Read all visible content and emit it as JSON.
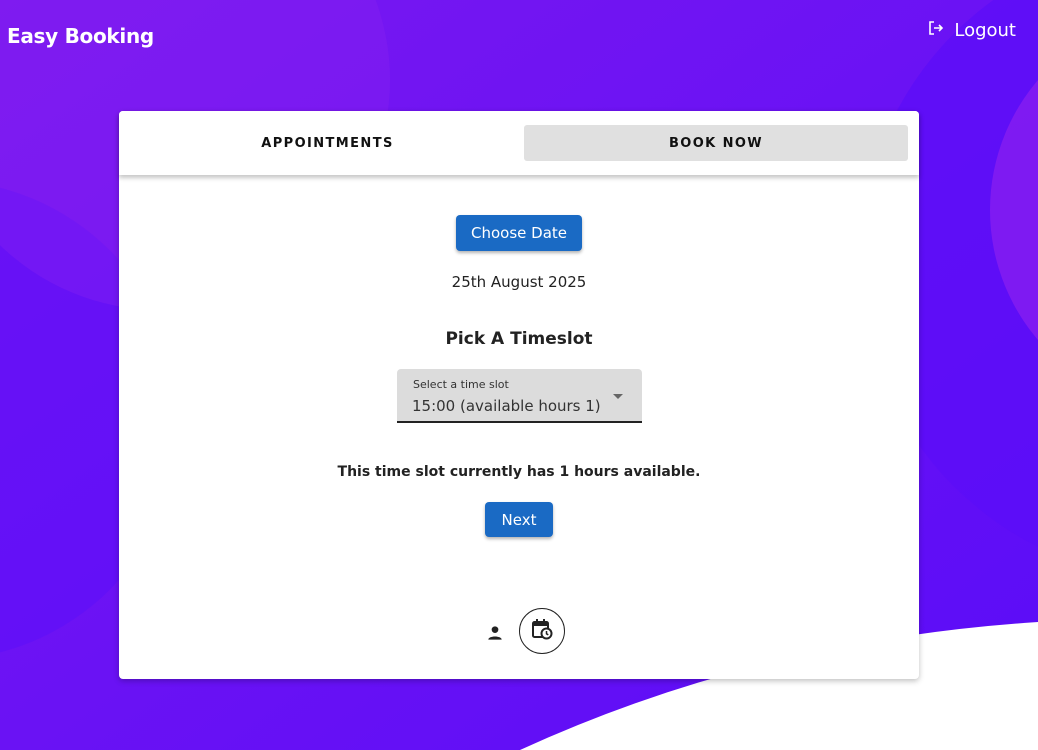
{
  "colors": {
    "background": "#6a14f2",
    "primary_button": "#1a6ac4",
    "selected_tab": "#e0e0e0"
  },
  "header": {
    "title": "Easy Booking",
    "logout_label": "Logout",
    "logout_icon": "logout-icon"
  },
  "tabs": [
    {
      "label": "APPOINTMENTS",
      "selected": false
    },
    {
      "label": "BOOK NOW",
      "selected": true
    }
  ],
  "booking": {
    "choose_date_label": "Choose Date",
    "selected_date": "25th August 2025",
    "timeslot_heading": "Pick A Timeslot",
    "timeslot_select": {
      "label": "Select a time slot",
      "value": "15:00 (available hours 1)"
    },
    "availability_text": "This time slot currently has 1 hours available.",
    "next_label": "Next"
  },
  "stepper": [
    {
      "icon": "person-icon",
      "active": false
    },
    {
      "icon": "calendar-clock-icon",
      "active": true
    }
  ]
}
